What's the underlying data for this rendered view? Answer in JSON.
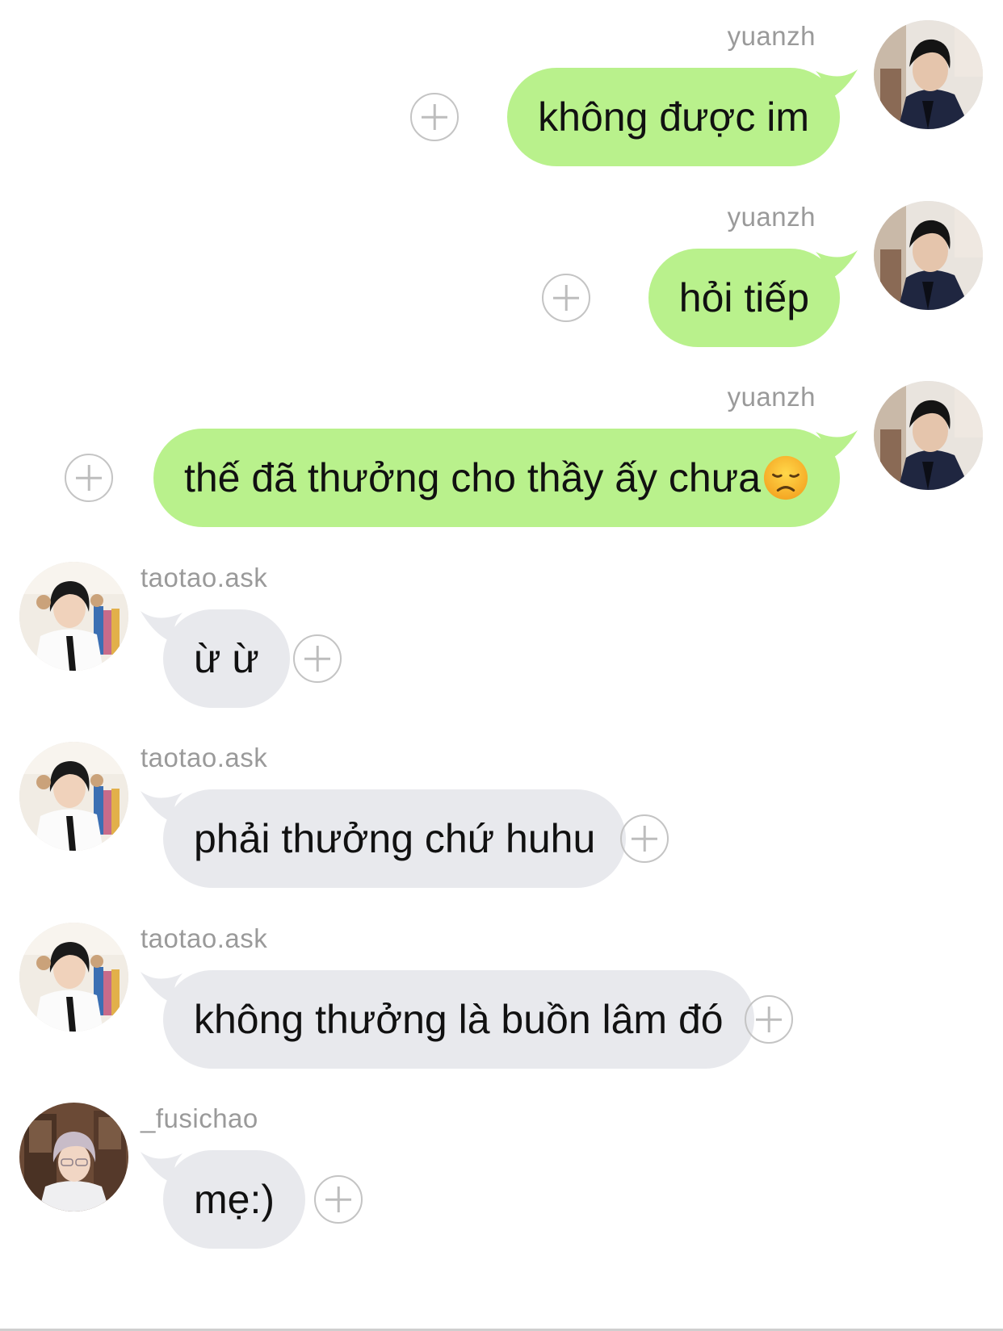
{
  "messages": [
    {
      "side": "out",
      "user": "yuanzh",
      "text": "không được im",
      "emoji": ""
    },
    {
      "side": "out",
      "user": "yuanzh",
      "text": "hỏi tiếp",
      "emoji": ""
    },
    {
      "side": "out",
      "user": "yuanzh",
      "text": "thế đã thưởng cho thầy ấy chưa",
      "emoji": "disappointed-face"
    },
    {
      "side": "in",
      "user": "taotao.ask",
      "text": "ừ ừ",
      "emoji": ""
    },
    {
      "side": "in",
      "user": "taotao.ask",
      "text": "phải thưởng chứ huhu",
      "emoji": ""
    },
    {
      "side": "in",
      "user": "taotao.ask",
      "text": "không thưởng là buồn lâm đó",
      "emoji": ""
    },
    {
      "side": "in",
      "user": "_fusichao",
      "text": "mẹ:)",
      "emoji": ""
    }
  ],
  "colors": {
    "outgoing_bubble": "#b9f18c",
    "incoming_bubble": "#e8e9ed",
    "username": "#9a9a9a",
    "add_button": "#c4c4c4"
  },
  "icons": {
    "add": "plus-circle-icon"
  }
}
